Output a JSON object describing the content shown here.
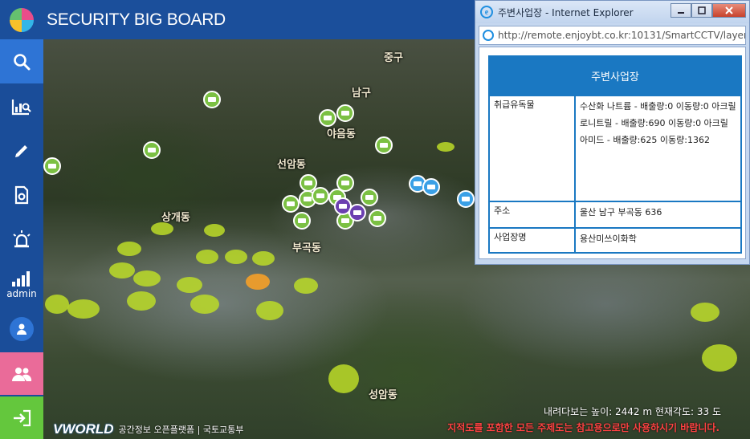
{
  "header": {
    "title": "SECURITY BIG BOARD"
  },
  "sidebar": {
    "admin_label": "admin"
  },
  "map": {
    "districts": [
      "중구",
      "남구",
      "야음동",
      "선암동",
      "상개동",
      "부곡동",
      "성암동"
    ],
    "readout": "내려다보는 높이: 2442 m  현재각도: 33 도",
    "vworld_logo": "VWORLD",
    "attribution": "공간정보 오픈플랫폼  |  국토교통부",
    "disclaimer": "지적도를 포함한 모든 주제도는 참고용으로만 사용하시기 바랍니다."
  },
  "popup": {
    "window_title": "주변사업장 - Internet Explorer",
    "url": "http://remote.enjoybt.co.kr:10131/SmartCCTV/layer/lay",
    "heading": "주변사업장",
    "rows": [
      {
        "label": "취급유독물",
        "value": "수산화 나트륨 - 배출량:0 이동량:0 아크릴로니트릴 - 배출량:690 이동량:0 아크릴아미드 - 배출량:625 이동량:1362"
      },
      {
        "label": "주소",
        "value": "울산 남구 부곡동 636"
      },
      {
        "label": "사업장명",
        "value": "용산미쓰이화학"
      }
    ]
  },
  "colors": {
    "header": "#1b4f9b",
    "sidebar_active": "#2e74d5",
    "sidebar_pink": "#ea6b99",
    "sidebar_green": "#64c73d",
    "table_border": "#1a78c2",
    "disclaimer": "#ff4242"
  }
}
